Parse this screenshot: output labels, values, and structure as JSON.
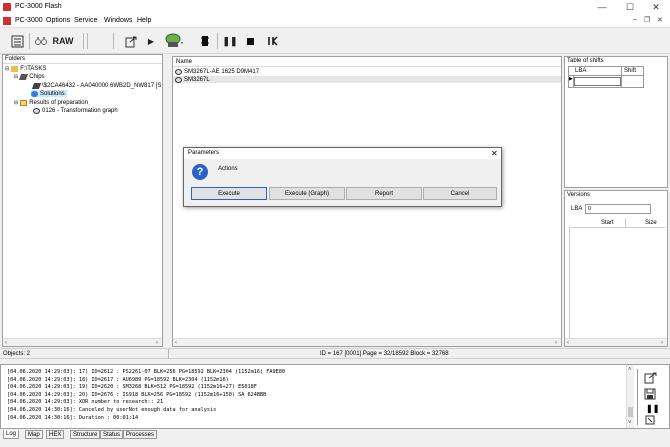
{
  "window": {
    "title": "PC-3000 Flash",
    "minimize": "—",
    "maximize": "☐",
    "close": "✕"
  },
  "menu": {
    "items": [
      "PC-3000",
      "Options",
      "Service",
      "Windows",
      "Help"
    ],
    "mdi_min": "–",
    "mdi_restore": "❐",
    "mdi_close": "✕"
  },
  "toolbar": {
    "raw_label": "RAW"
  },
  "folders": {
    "header": "Folders",
    "items": [
      {
        "label": "F:\\TASKS"
      },
      {
        "label": "Chips"
      },
      {
        "label": "\\$2CA46432 - AA040000 6WB2D_NW817 [S"
      },
      {
        "label": "Solutions"
      },
      {
        "label": "Results of preparation"
      },
      {
        "label": "0126 - Transformation graph"
      }
    ]
  },
  "name_list": {
    "header": "Name",
    "items": [
      {
        "label": "SM3267L-AE 1625 D9M417"
      },
      {
        "label": "SM3267L"
      }
    ]
  },
  "shifts": {
    "title": "Table of shifts",
    "col_lba": "LBA",
    "col_shift": "Shift"
  },
  "versions": {
    "title": "Versions",
    "lba_label": "LBA",
    "lba_value": "0",
    "col_start": "Start",
    "col_size": "Size"
  },
  "dialog": {
    "title": "Parameters",
    "close": "✕",
    "message": "Actions",
    "buttons": {
      "execute": "Execute",
      "execute_graph": "Execute (Graph)",
      "report": "Report",
      "cancel": "Cancel"
    }
  },
  "status": {
    "objects": "Objects: 2",
    "info": "ID = 167 [0001] Page  = 32/18592 Block = 32768"
  },
  "log": {
    "lines": [
      "[04.06.2020 14:29:03]: 17) ID=2612 : PS2261-07 BLK=256 PG=18592 BLK=2304 (1152m16) FA9E80",
      "[04.06.2020 14:29:03]: 18) ID=2617 : AU6989 PG=18592 BLK=2304 (1152m16)",
      "[04.06.2020 14:29:03]: 19) ID=2620 : SM3268 BLK=512 PG=18592 (1152m16+27) E5018F",
      "[04.06.2020 14:29:03]: 20) ID=2676 : IS918 BLK=256 PG=18592 (1152m16+150) SA 624BBB",
      "[04.06.2020 14:29:03]: XOR number to research:: 21",
      "[04.06.2020 14:30:16]: Canceled by userNot enough data for analysis",
      "[04.06.2020 14:30:16]: Duration : 00:01:14"
    ],
    "tabs": [
      "Log",
      "Map",
      "HEX",
      "Structure",
      "Status",
      "Processes"
    ]
  },
  "colors": {
    "app_icon": "#d03030",
    "selection": "#cce8ff",
    "info_icon": "#2a62c8"
  }
}
